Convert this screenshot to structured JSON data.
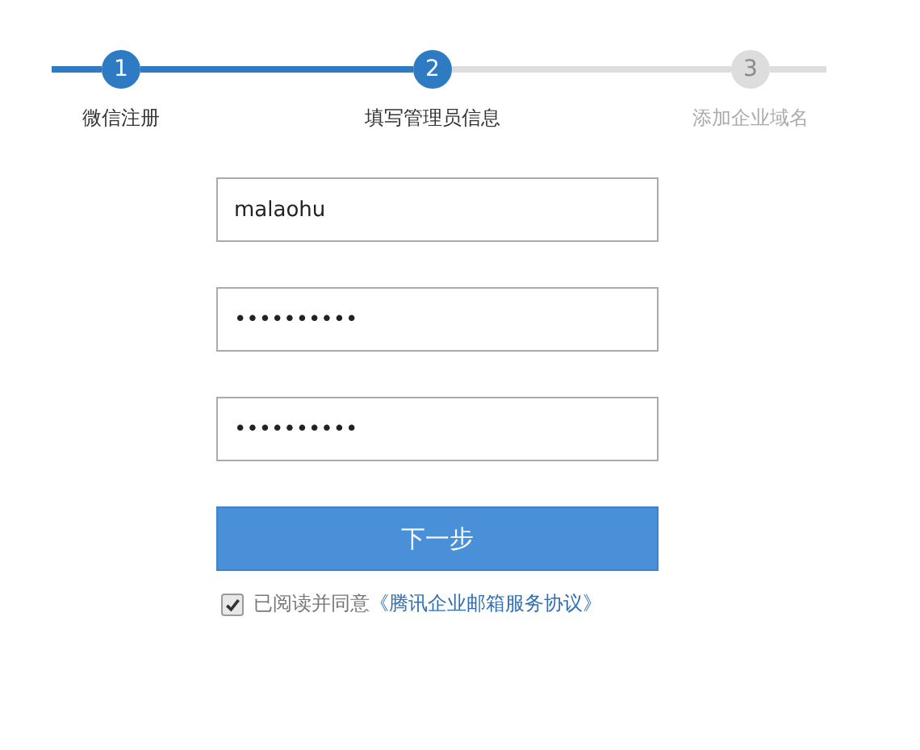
{
  "steps": [
    {
      "number": "1",
      "label": "微信注册",
      "active": true
    },
    {
      "number": "2",
      "label": "填写管理员信息",
      "active": true
    },
    {
      "number": "3",
      "label": "添加企业域名",
      "active": false
    }
  ],
  "fields": [
    {
      "value": "malaohu"
    },
    {
      "value": "••••••••••"
    },
    {
      "value": "••••••••••"
    }
  ],
  "submit_button": "下一步",
  "agreement": {
    "checked": true,
    "text": "已阅读并同意",
    "link": "《腾讯企业邮箱服务协议》"
  }
}
